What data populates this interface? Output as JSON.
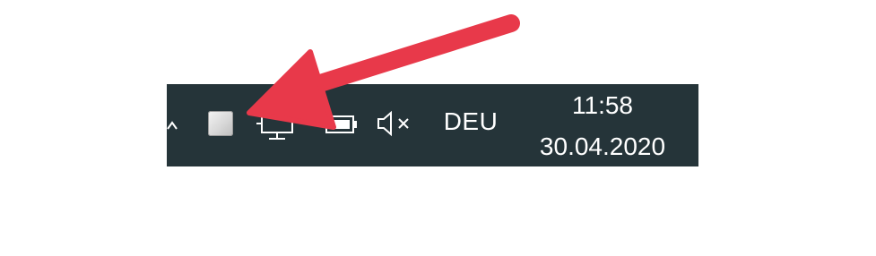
{
  "taskbar": {
    "language": "DEU",
    "clock": {
      "time": "11:58",
      "date": "30.04.2020"
    },
    "icons": [
      "chevron-up-icon",
      "app-tray-icon",
      "network-icon",
      "battery-charging-icon",
      "volume-muted-icon"
    ],
    "background_color": "#253439"
  },
  "annotation": {
    "arrow_color": "#e8394a"
  }
}
